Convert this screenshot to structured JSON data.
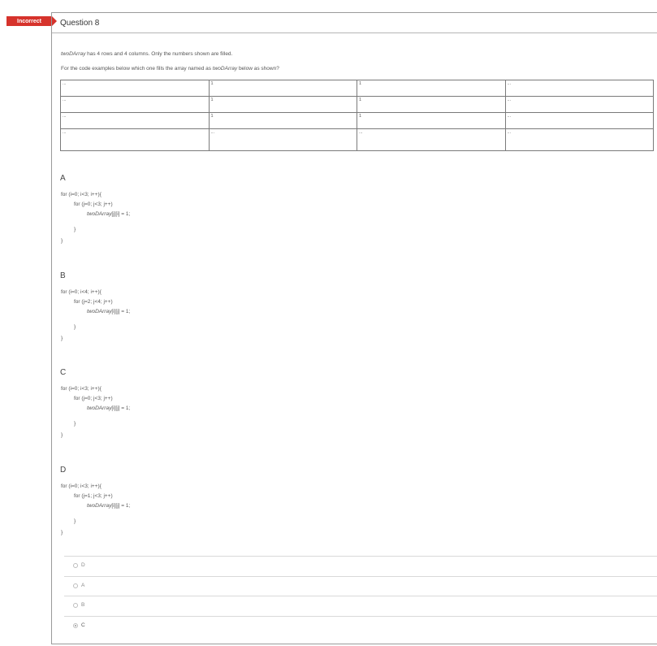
{
  "status_badge": "Incorrect",
  "question_title": "Question 8",
  "intro": {
    "line1_var": "twoDArray",
    "line1_rest": " has 4 rows and 4 columns. Only the numbers shown are filled.",
    "line2_pre": "For the code examples below which one fills the array named as ",
    "line2_var": "twoDArray",
    "line2_post": " below as shown?"
  },
  "grid": [
    [
      "...",
      "1",
      "1",
      "..."
    ],
    [
      "...",
      "1",
      "1",
      "..."
    ],
    [
      "...",
      "1",
      "1",
      "..."
    ],
    [
      "...",
      "...",
      "...",
      "..."
    ]
  ],
  "options": [
    {
      "letter": "A",
      "outer": "for (i=0; i<3; i++){",
      "inner": "for (j=0; j<3; j++)",
      "stmt_var": "twoDArray",
      "stmt_rest": "[j][i] = 1;",
      "brace_inner": "}",
      "brace_outer": "}"
    },
    {
      "letter": "B",
      "outer": "for (i=0; i<4; i++){",
      "inner": "for (j=2; j<4; j++)",
      "stmt_var": "twoDArray",
      "stmt_rest": "[i][j] = 1;",
      "brace_inner": "}",
      "brace_outer": "}"
    },
    {
      "letter": "C",
      "outer": "for (i=0; i<3; i++){",
      "inner": "for (j=0; j<3; j++)",
      "stmt_var": "twoDArray",
      "stmt_rest": "[i][j] = 1;",
      "brace_inner": "}",
      "brace_outer": "}"
    },
    {
      "letter": "D",
      "outer": "for (i=0; i<3; i++){",
      "inner": "for (j=1; j<3; j++)",
      "stmt_var": "twoDArray",
      "stmt_rest": "[i][j] = 1;",
      "brace_inner": "}",
      "brace_outer": "}"
    }
  ],
  "answers": [
    {
      "label": "D",
      "selected": false
    },
    {
      "label": "A",
      "selected": false
    },
    {
      "label": "B",
      "selected": false
    },
    {
      "label": "C",
      "selected": true
    }
  ]
}
